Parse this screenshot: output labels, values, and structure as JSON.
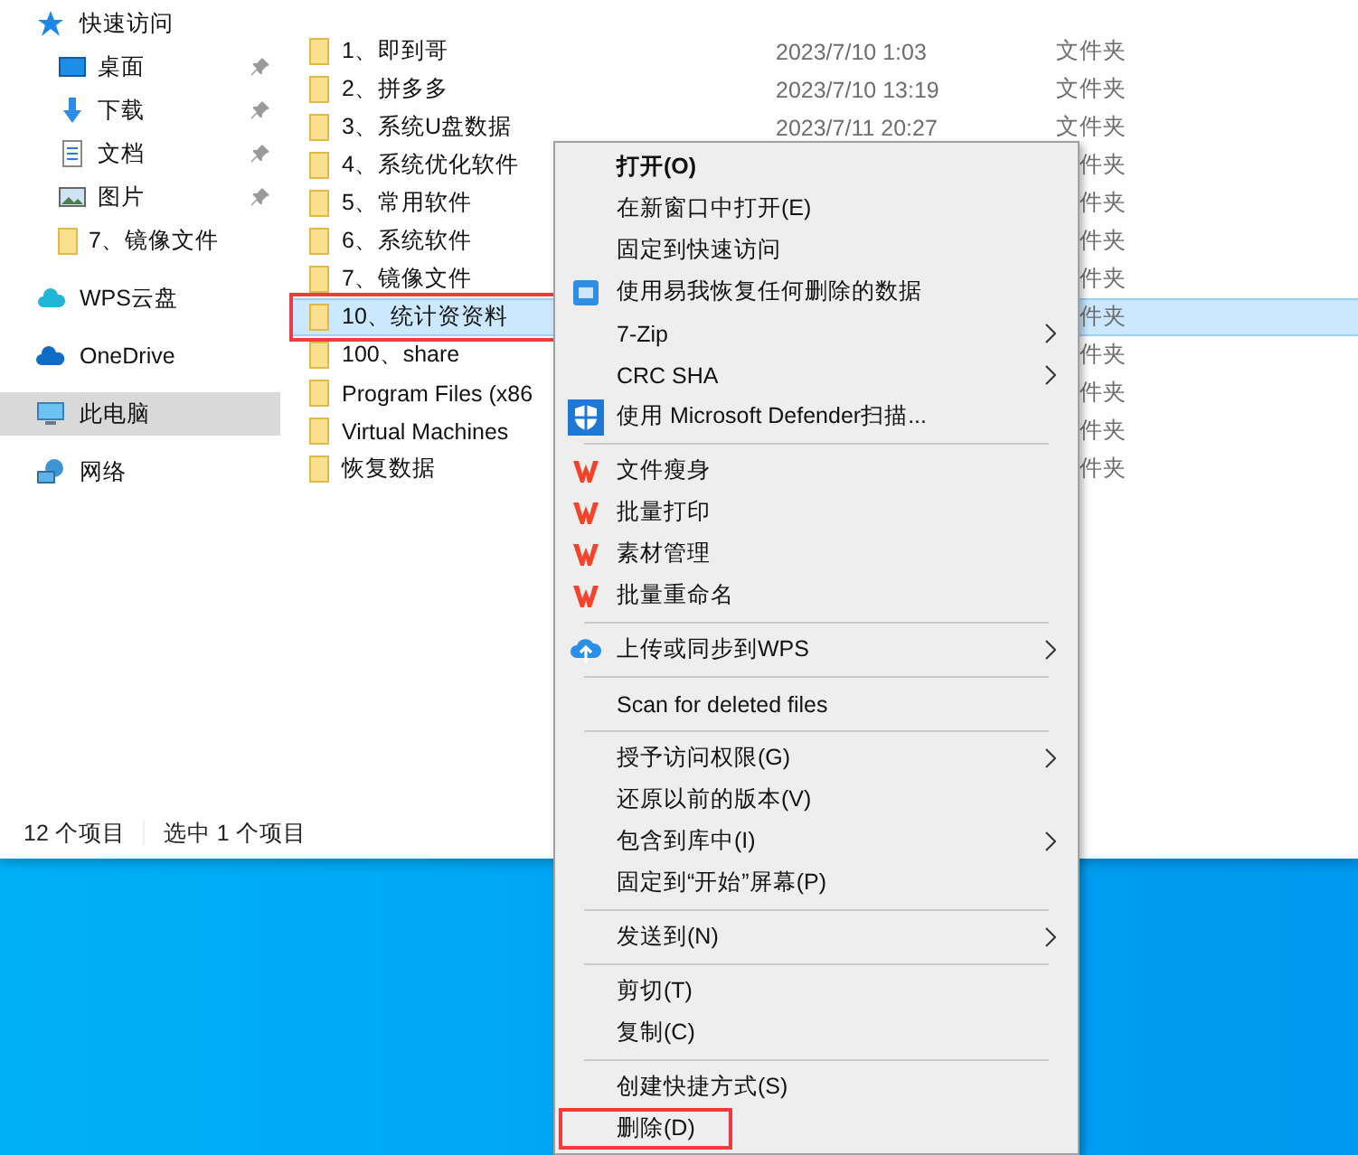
{
  "sidebar": {
    "items": [
      {
        "label": "快速访问",
        "kind": "quick-access",
        "selected": false,
        "children": [
          {
            "label": "桌面",
            "kind": "desktop",
            "pinned": true,
            "selected": false
          },
          {
            "label": "下载",
            "kind": "downloads",
            "pinned": true,
            "selected": false
          },
          {
            "label": "文档",
            "kind": "documents",
            "pinned": true,
            "selected": false
          },
          {
            "label": "图片",
            "kind": "pictures",
            "pinned": true,
            "selected": false
          },
          {
            "label": "7、镜像文件",
            "kind": "folder",
            "pinned": false,
            "selected": false
          }
        ]
      },
      {
        "label": "WPS云盘",
        "kind": "wps-cloud",
        "selected": false
      },
      {
        "label": "OneDrive",
        "kind": "onedrive",
        "selected": false
      },
      {
        "label": "此电脑",
        "kind": "this-pc",
        "selected": true
      },
      {
        "label": "网络",
        "kind": "network",
        "selected": false
      }
    ]
  },
  "files": {
    "rows": [
      {
        "name": "1、即到哥",
        "date": "2023/7/10 1:03",
        "type": "文件夹",
        "selected": false,
        "annotated": false
      },
      {
        "name": "2、拼多多",
        "date": "2023/7/10 13:19",
        "type": "文件夹",
        "selected": false,
        "annotated": false
      },
      {
        "name": "3、系统U盘数据",
        "date": "2023/7/11 20:27",
        "type": "文件夹",
        "selected": false,
        "annotated": false
      },
      {
        "name": "4、系统优化软件",
        "type": "件夹",
        "selected": false,
        "annotated": false
      },
      {
        "name": "5、常用软件",
        "type": "件夹",
        "selected": false,
        "annotated": false
      },
      {
        "name": "6、系统软件",
        "type": "件夹",
        "selected": false,
        "annotated": false
      },
      {
        "name": "7、镜像文件",
        "type": "件夹",
        "selected": false,
        "annotated": false
      },
      {
        "name": "10、统计资资料",
        "type": "件夹",
        "selected": true,
        "annotated": true
      },
      {
        "name": "100、share",
        "type": "件夹",
        "selected": false,
        "annotated": false
      },
      {
        "name": "Program Files (x86",
        "type": "件夹",
        "selected": false,
        "annotated": false
      },
      {
        "name": "Virtual Machines",
        "type": "件夹",
        "selected": false,
        "annotated": false
      },
      {
        "name": "恢复数据",
        "type": "件夹",
        "selected": false,
        "annotated": false
      }
    ]
  },
  "status_bar": [
    "12 个项目",
    "选中 1 个项目"
  ],
  "context_menu": {
    "items": [
      {
        "kind": "plain",
        "label": "打开(O)",
        "default": true,
        "submenu": false,
        "annotated": false
      },
      {
        "kind": "plain",
        "label": "在新窗口中打开(E)",
        "default": false,
        "submenu": false,
        "annotated": false
      },
      {
        "kind": "plain",
        "label": "固定到快速访问",
        "default": false,
        "submenu": false,
        "annotated": false
      },
      {
        "kind": "recovery",
        "label": "使用易我恢复任何删除的数据",
        "default": false,
        "submenu": false,
        "annotated": false
      },
      {
        "kind": "plain",
        "label": "7-Zip",
        "default": false,
        "submenu": true,
        "annotated": false
      },
      {
        "kind": "plain",
        "label": "CRC SHA",
        "default": false,
        "submenu": true,
        "annotated": false
      },
      {
        "kind": "defender",
        "label": "使用 Microsoft Defender扫描...",
        "default": false,
        "submenu": false,
        "annotated": false
      },
      {
        "kind": "separator"
      },
      {
        "kind": "wps",
        "label": "文件瘦身",
        "default": false,
        "submenu": false,
        "annotated": false
      },
      {
        "kind": "wps",
        "label": "批量打印",
        "default": false,
        "submenu": false,
        "annotated": false
      },
      {
        "kind": "wps",
        "label": "素材管理",
        "default": false,
        "submenu": false,
        "annotated": false
      },
      {
        "kind": "wps",
        "label": "批量重命名",
        "default": false,
        "submenu": false,
        "annotated": false
      },
      {
        "kind": "separator"
      },
      {
        "kind": "upload",
        "label": "上传或同步到WPS",
        "default": false,
        "submenu": true,
        "annotated": false
      },
      {
        "kind": "separator"
      },
      {
        "kind": "plain",
        "label": "Scan for deleted files",
        "default": false,
        "submenu": false,
        "annotated": false
      },
      {
        "kind": "separator"
      },
      {
        "kind": "plain",
        "label": "授予访问权限(G)",
        "default": false,
        "submenu": true,
        "annotated": false
      },
      {
        "kind": "plain",
        "label": "还原以前的版本(V)",
        "default": false,
        "submenu": false,
        "annotated": false
      },
      {
        "kind": "plain",
        "label": "包含到库中(I)",
        "default": false,
        "submenu": true,
        "annotated": false
      },
      {
        "kind": "plain",
        "label": "固定到“开始”屏幕(P)",
        "default": false,
        "submenu": false,
        "annotated": false
      },
      {
        "kind": "separator"
      },
      {
        "kind": "plain",
        "label": "发送到(N)",
        "default": false,
        "submenu": true,
        "annotated": false
      },
      {
        "kind": "separator"
      },
      {
        "kind": "plain",
        "label": "剪切(T)",
        "default": false,
        "submenu": false,
        "annotated": false
      },
      {
        "kind": "plain",
        "label": "复制(C)",
        "default": false,
        "submenu": false,
        "annotated": false
      },
      {
        "kind": "separator"
      },
      {
        "kind": "plain",
        "label": "创建快捷方式(S)",
        "default": false,
        "submenu": false,
        "annotated": false
      },
      {
        "kind": "plain",
        "label": "删除(D)",
        "default": false,
        "submenu": false,
        "annotated": true
      }
    ]
  }
}
